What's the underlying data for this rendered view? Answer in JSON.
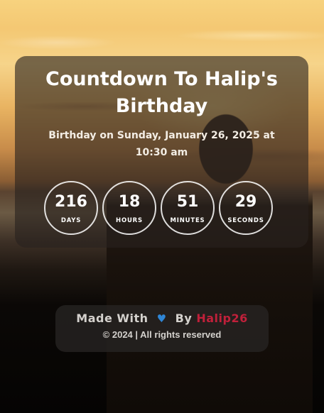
{
  "header": {
    "title": "Countdown To Halip's Birthday",
    "subtitle": "Birthday on Sunday, January 26, 2025 at 10:30 am"
  },
  "countdown": {
    "days": {
      "value": "216",
      "label": "DAYS"
    },
    "hours": {
      "value": "18",
      "label": "HOURS"
    },
    "minutes": {
      "value": "51",
      "label": "MINUTES"
    },
    "seconds": {
      "value": "29",
      "label": "SECONDS"
    }
  },
  "footer": {
    "made_with": "Made With",
    "heart_icon": "blue-heart-icon",
    "by": "By",
    "author": "Halip26",
    "copyright": "© 2024 | All rights reserved"
  },
  "colors": {
    "author": "#c0203a",
    "heart": "#2f86d6"
  }
}
